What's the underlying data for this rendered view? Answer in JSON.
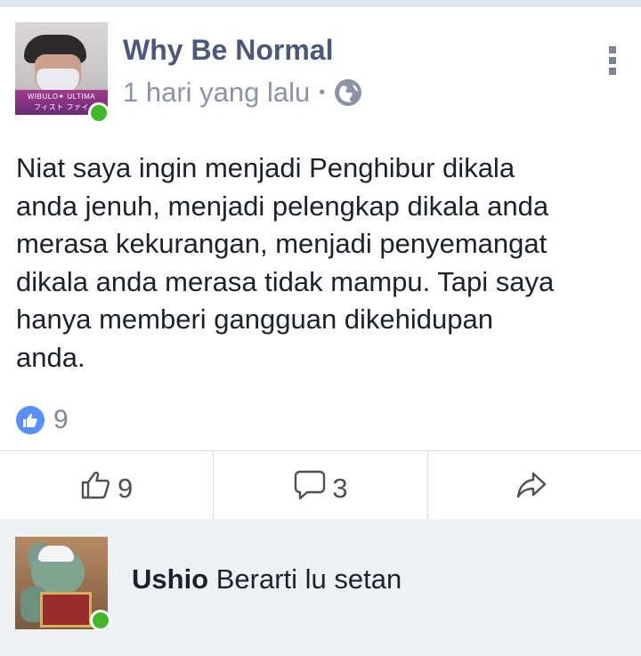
{
  "post": {
    "author": "Why Be Normal",
    "timestamp": "1 hari yang lalu",
    "separator": "•",
    "avatar_tag": "WIBULO✦ ULTIMA\nフィスト ファイ",
    "body": "Niat saya ingin menjadi Penghibur dikala\nanda jenuh, menjadi pelengkap dikala anda\nmerasa kekurangan, menjadi penyemangat\ndikala anda merasa tidak mampu.  Tapi saya\nhanya memberi gangguan dikehidupan\nanda.",
    "reaction_count": "9",
    "icons": {
      "audience": "globe-icon",
      "menu": "vertical-ellipsis-icon",
      "reaction": "like-bubble-icon"
    }
  },
  "actions": [
    {
      "name": "like",
      "icon": "thumbs-up-icon",
      "count": "9"
    },
    {
      "name": "comment",
      "icon": "comment-bubble-icon",
      "count": "3"
    },
    {
      "name": "share",
      "icon": "share-arrow-icon",
      "count": ""
    }
  ],
  "comment": {
    "author": "Ushio",
    "text": "Berarti lu setan"
  },
  "colors": {
    "author_name": "#4b5877",
    "meta_text": "#8b93a6",
    "online": "#42b72a",
    "like_blue": "#5890ff",
    "background": "#e9ebee"
  }
}
